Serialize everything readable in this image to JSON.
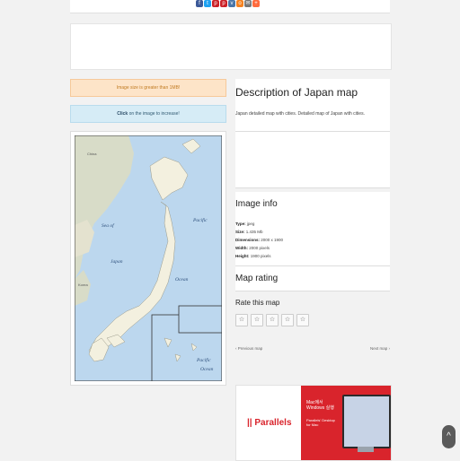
{
  "share_icons": [
    "facebook-icon",
    "twitter-icon",
    "pinterest-icon",
    "pinterest-icon",
    "vk-icon",
    "odnoklassniki-icon",
    "email-icon",
    "more-icon"
  ],
  "share_colors": [
    "#3b5998",
    "#1da1f2",
    "#cb2027",
    "#cb2027",
    "#4a76a8",
    "#f58220",
    "#777777",
    "#ff6a3d"
  ],
  "alerts": {
    "size_warning": "Image size is greater than 1MB!",
    "click_prefix": "Click",
    "click_suffix": " on the image to increase!"
  },
  "map": {
    "labels": [
      "Sea of",
      "Japan",
      "Pacific",
      "Ocean",
      "Pacific",
      "Ocean",
      "China",
      "Korea"
    ]
  },
  "description": {
    "title": "Description of Japan map",
    "text": "Japan detailed map with cities. Detailed map of Japan with cities."
  },
  "image_info": {
    "title": "Image info",
    "type_label": "Type:",
    "type_value": " jpeg",
    "size_label": "Size:",
    "size_value": " 1.435 Mb",
    "dimensions_label": "Dimensions:",
    "dimensions_value": " 2000 x 1900",
    "width_label": "Width:",
    "width_value": " 2000 pixels",
    "height_label": "Height:",
    "height_value": " 1900 pixels"
  },
  "rating": {
    "title": "Map rating",
    "subtitle": "Rate this map",
    "stars": [
      "☆",
      "☆",
      "☆",
      "☆",
      "☆"
    ]
  },
  "nav": {
    "previous": "Previous map",
    "next": "Next map"
  },
  "ad": {
    "brand": "|| Parallels",
    "headline_line1": "Mac에서",
    "headline_line2": "Windows 실행",
    "product_line1": "Parallels' Desktop",
    "product_line2": "for Mac"
  },
  "scroll_top_symbol": "^"
}
